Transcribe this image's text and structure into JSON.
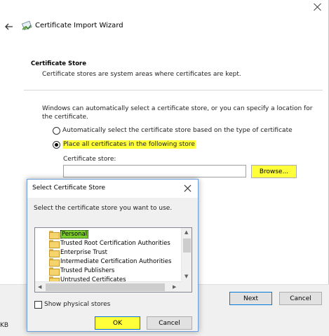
{
  "wizard": {
    "title": "Certificate Import Wizard",
    "section_title": "Certificate Store",
    "section_desc": "Certificate stores are system areas where certificates are kept.",
    "intro": "Windows can automatically select a certificate store, or you can specify a location for the certificate.",
    "option_auto": "Automatically select the certificate store based on the type of certificate",
    "option_manual": "Place all certificates in the following store",
    "store_label": "Certificate store:",
    "store_value": "",
    "browse_label": "Browse...",
    "next_label": "Next",
    "cancel_label": "Cancel",
    "left_fragment": "KB",
    "selected_option": "manual"
  },
  "dialog": {
    "title": "Select Certificate Store",
    "prompt": "Select the certificate store you want to use.",
    "stores": [
      "Personal",
      "Trusted Root Certification Authorities",
      "Enterprise Trust",
      "Intermediate Certification Authorities",
      "Trusted Publishers",
      "Untrusted Certificates"
    ],
    "selected_store": "Personal",
    "show_physical_label": "Show physical stores",
    "show_physical_checked": false,
    "ok_label": "OK",
    "cancel_label": "Cancel"
  },
  "colors": {
    "highlight": "#ffff3a",
    "selection": "#7ecb2d",
    "focus_border": "#0078d7"
  }
}
